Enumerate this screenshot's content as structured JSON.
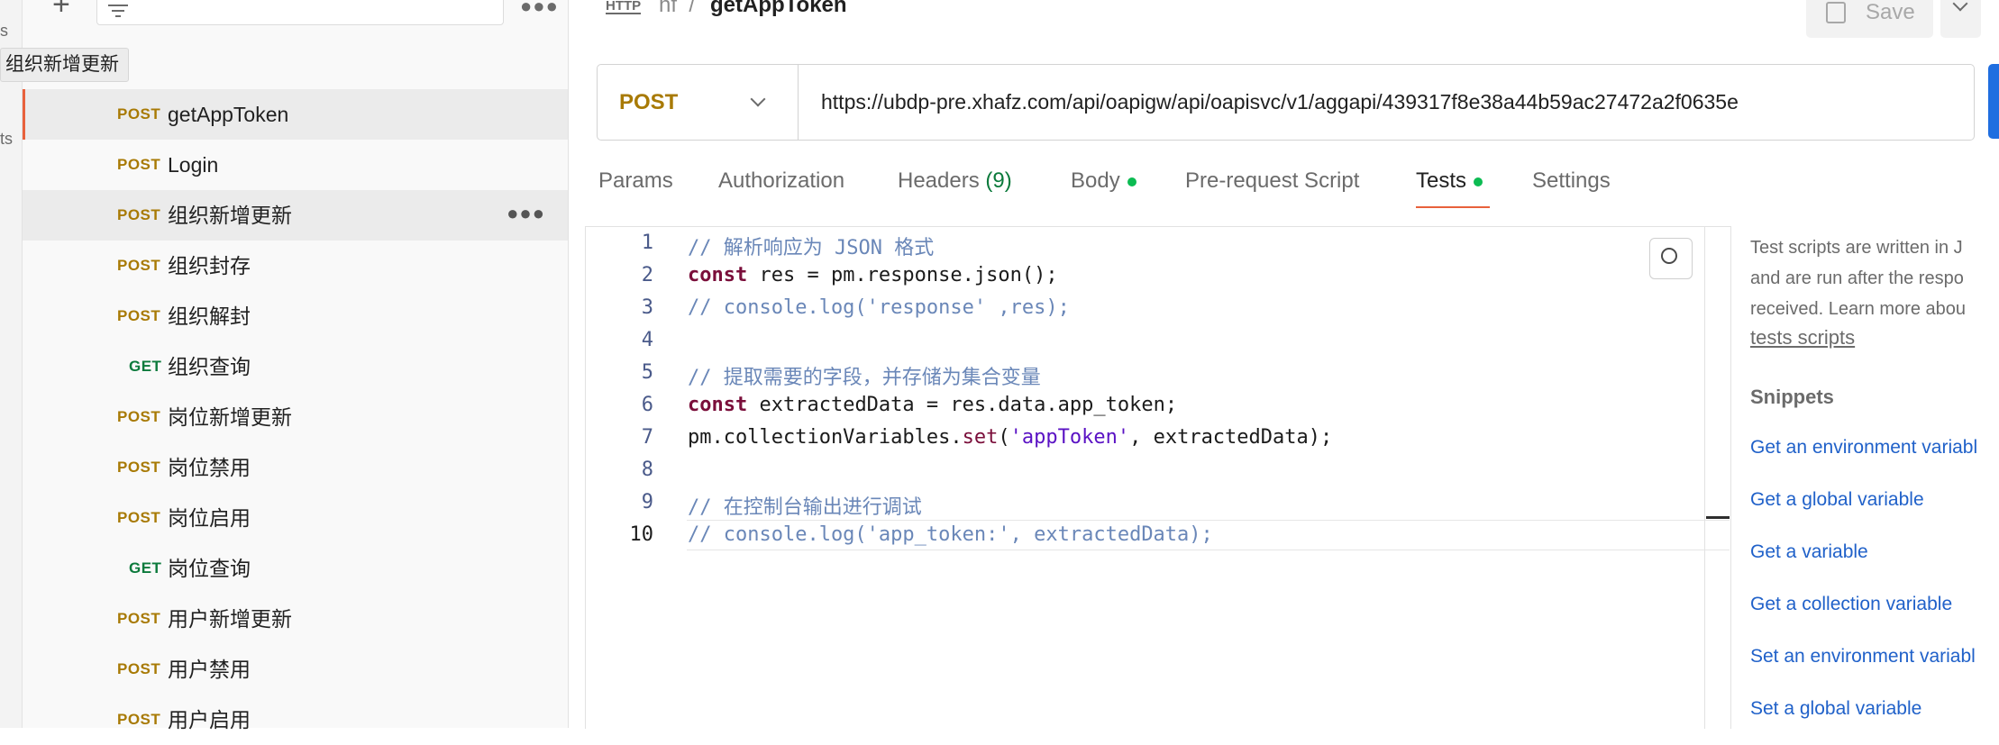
{
  "rail": {
    "label_top": "s",
    "label_mid": "ts"
  },
  "sidebar": {
    "tooltip": "组织新增更新",
    "items": [
      {
        "method": "POST",
        "name": "getAppToken"
      },
      {
        "method": "POST",
        "name": "Login"
      },
      {
        "method": "POST",
        "name": "组织新增更新"
      },
      {
        "method": "POST",
        "name": "组织封存"
      },
      {
        "method": "POST",
        "name": "组织解封"
      },
      {
        "method": "GET",
        "name": "组织查询"
      },
      {
        "method": "POST",
        "name": "岗位新增更新"
      },
      {
        "method": "POST",
        "name": "岗位禁用"
      },
      {
        "method": "POST",
        "name": "岗位启用"
      },
      {
        "method": "GET",
        "name": "岗位查询"
      },
      {
        "method": "POST",
        "name": "用户新增更新"
      },
      {
        "method": "POST",
        "name": "用户禁用"
      },
      {
        "method": "POST",
        "name": "用户启用"
      }
    ]
  },
  "header": {
    "http_icon": "HTTP",
    "breadcrumb_parent": "hf",
    "separator": "/",
    "title": "getAppToken",
    "save_label": "Save"
  },
  "request": {
    "method": "POST",
    "url": "https://ubdp-pre.xhafz.com/api/oapigw/api/oapisvc/v1/aggapi/439317f8e38a44b59ac27472a2f0635e"
  },
  "tabs": [
    {
      "label": "Params"
    },
    {
      "label": "Authorization"
    },
    {
      "label": "Headers",
      "count": "(9)"
    },
    {
      "label": "Body"
    },
    {
      "label": "Pre-request Script"
    },
    {
      "label": "Tests"
    },
    {
      "label": "Settings"
    }
  ],
  "editor": {
    "line_numbers": [
      "1",
      "2",
      "3",
      "4",
      "5",
      "6",
      "7",
      "8",
      "9",
      "10"
    ],
    "code": {
      "l1": "// 解析响应为 JSON 格式",
      "l2_kw": "const",
      "l2_rest": " res = pm.response.json();",
      "l3": "// console.log('response' ,res);",
      "l5": "// 提取需要的字段，并存储为集合变量",
      "l6_kw": "const",
      "l6_rest": " extractedData = res.data.app_token;",
      "l7_pre": "pm.collectionVariables.",
      "l7_fn": "set",
      "l7_open": "(",
      "l7_str": "'appToken'",
      "l7_rest": ", extractedData);",
      "l9": "// 在控制台输出进行调试",
      "l10": "// console.log('app_token:', extractedData);"
    }
  },
  "right_panel": {
    "desc_line1": "Test scripts are written in J",
    "desc_line2": "and are run after the respo",
    "desc_line3": "received. Learn more abou",
    "learn_link": "tests scripts",
    "snippets_heading": "Snippets",
    "snippets": [
      "Get an environment variabl",
      "Get a global variable",
      "Get a variable",
      "Get a collection variable",
      "Set an environment variabl",
      "Set a global variable"
    ]
  },
  "colors": {
    "post": "#a87a05",
    "get": "#0c7a3c",
    "accent": "#e8613c",
    "link": "#2061c9",
    "dot": "#0cbb52"
  }
}
